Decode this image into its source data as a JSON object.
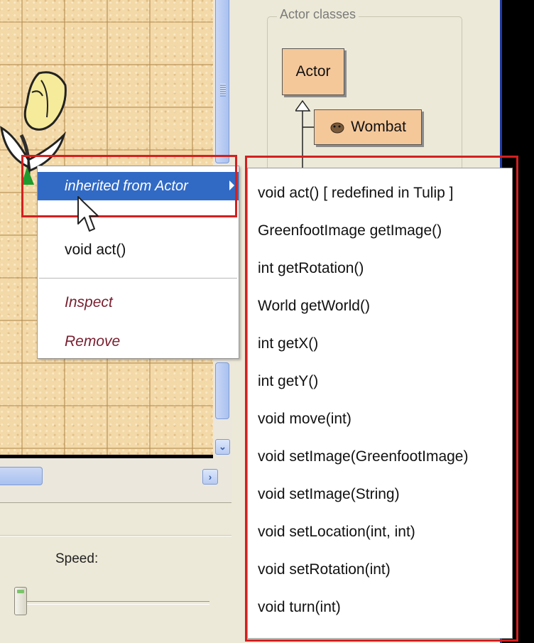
{
  "class_panel": {
    "group_title": "Actor classes",
    "classes": [
      {
        "name": "Actor"
      },
      {
        "name": "Wombat",
        "icon": "wombat-icon"
      }
    ]
  },
  "context_menu": {
    "items": [
      {
        "label": "inherited from Actor",
        "highlighted": true,
        "has_submenu": true
      },
      {
        "label": "void act()"
      },
      {
        "label": "Inspect"
      },
      {
        "label": "Remove"
      }
    ]
  },
  "submenu": {
    "items": [
      "void act()   [ redefined in Tulip ]",
      "GreenfootImage getImage()",
      "int getRotation()",
      "World getWorld()",
      "int getX()",
      "int getY()",
      "void move(int)",
      "void setImage(GreenfootImage)",
      "void setImage(String)",
      "void setLocation(int, int)",
      "void setRotation(int)",
      "void turn(int)"
    ]
  },
  "controls": {
    "speed_label": "Speed:"
  },
  "colors": {
    "highlight": "#316ac5",
    "annotation": "#d42020",
    "class_fill": "#f5c89a",
    "menu_italic": "#7a2030"
  }
}
